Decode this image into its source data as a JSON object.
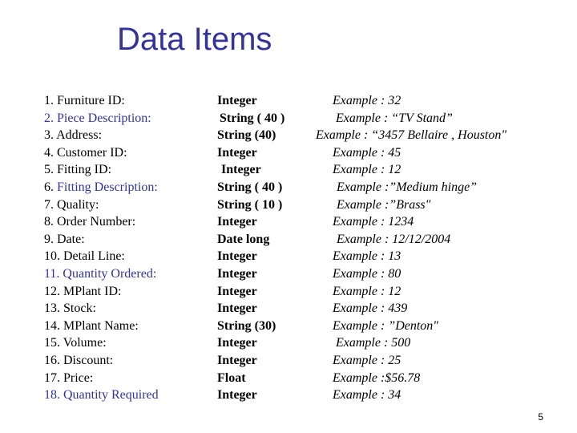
{
  "slide": {
    "title": "Data Items",
    "page_number": "5",
    "accent_color": "#333399",
    "items": [
      {
        "num": "1.",
        "label": "Furniture ID:",
        "type": " Integer",
        "example": "Example : 32",
        "highlight": "none"
      },
      {
        "num": "2.",
        "label": "Piece Description:",
        "type": "  String ( 40 )",
        "example": "Example : “TV Stand”",
        "highlight": "all"
      },
      {
        "num": "3.",
        "label": "Address:",
        "type": " String (40)",
        "example": "Example : “3457 Bellaire , Houston\"",
        "highlight": "none"
      },
      {
        "num": "4.",
        "label": "Customer ID:",
        "type": " Integer",
        "example": "Example : 45",
        "highlight": "none"
      },
      {
        "num": "5.",
        "label": "Fitting ID:",
        "type": "  Integer",
        "example": "Example : 12",
        "highlight": "none"
      },
      {
        "num": "6.",
        "label": "Fitting Description:",
        "type": " String ( 40 )",
        "example": "Example :”Medium hinge”",
        "highlight": "label"
      },
      {
        "num": "7.",
        "label": "Quality:",
        "type": " String ( 10 )",
        "example": "Example :”Brass\"",
        "highlight": "none"
      },
      {
        "num": "8.",
        "label": "Order Number:",
        "type": " Integer",
        "example": "Example : 1234",
        "highlight": "none"
      },
      {
        "num": "9.",
        "label": "Date:",
        "type": " Date long",
        "example": "Example : 12/12/2004",
        "highlight": "none"
      },
      {
        "num": "10.",
        "label": "Detail Line:",
        "type": " Integer",
        "example": "Example : 13",
        "highlight": "none"
      },
      {
        "num": "11.",
        "label": "Quantity Ordered:",
        "type": " Integer",
        "example": "Example : 80",
        "highlight": "all"
      },
      {
        "num": "12.",
        "label": "MPlant ID:",
        "type": " Integer",
        "example": "Example : 12",
        "highlight": "none"
      },
      {
        "num": "13.",
        "label": "Stock:",
        "type": " Integer",
        "example": "Example : 439",
        "highlight": "none"
      },
      {
        "num": "14.",
        "label": "MPlant Name:",
        "type": " String (30)",
        "example": "Example : ”Denton\"",
        "highlight": "none"
      },
      {
        "num": "15.",
        "label": "Volume:",
        "type": " Integer",
        "example": "Example : 500",
        "highlight": "none"
      },
      {
        "num": "16.",
        "label": "Discount:",
        "type": " Integer",
        "example": "Example : 25",
        "highlight": "none"
      },
      {
        "num": "17.",
        "label": "Price:",
        "type": " Float",
        "example": "Example :$56.78",
        "highlight": "none"
      },
      {
        "num": "18.",
        "label": "Quantity Required",
        "type": " Integer",
        "example": "Example : 34",
        "highlight": "all"
      }
    ]
  }
}
